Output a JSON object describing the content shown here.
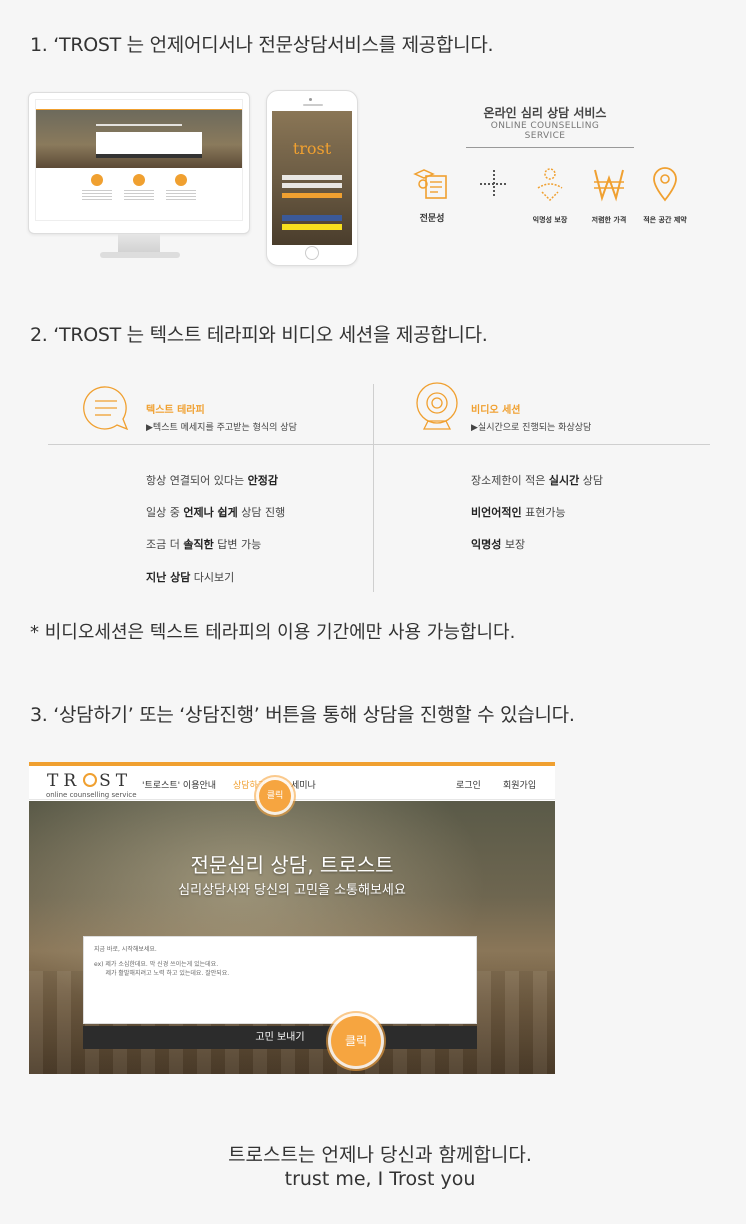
{
  "section1": {
    "title": "1. ‘TROST 는 언제어디서나 전문상담서비스를 제공합니다.",
    "service_title": "온라인 심리 상담 서비스",
    "service_subtitle": "ONLINE COUNSELLING SERVICE",
    "phone_logo": "trost",
    "features": [
      {
        "label": "전문성",
        "icon": "certificate-icon"
      },
      {
        "label": "",
        "icon": "plus-icon"
      },
      {
        "label": "익명성 보장",
        "icon": "anonymous-user-icon"
      },
      {
        "label": "저렴한 가격",
        "icon": "won-icon"
      },
      {
        "label": "적은 공간 제약",
        "icon": "location-pin-icon"
      }
    ]
  },
  "section2": {
    "title": "2. ‘TROST 는 텍스트 테라피와 비디오 세션을 제공합니다.",
    "text_therapy": {
      "heading": "텍스트 테라피",
      "desc": "텍스트 메세지를 주고받는 형식의 상담",
      "icon": "chat-bubble-icon",
      "points": [
        {
          "pre": "항상 연결되어 있다는 ",
          "bold": "안정감",
          "post": ""
        },
        {
          "pre": "일상 중 ",
          "bold": "언제나 쉽게",
          "post": " 상담 진행"
        },
        {
          "pre": "조금 더 ",
          "bold": "솔직한",
          "post": " 답변 가능"
        },
        {
          "pre": "",
          "bold": "지난 상담",
          "post": " 다시보기"
        }
      ]
    },
    "video_session": {
      "heading": "비디오 세션",
      "desc": "실시간으로 진행되는 화상상담",
      "icon": "webcam-icon",
      "points": [
        {
          "pre": "장소제한이 적은 ",
          "bold": "실시간",
          "post": " 상담"
        },
        {
          "pre": "",
          "bold": "비언어적인",
          "post": " 표현가능"
        },
        {
          "pre": "",
          "bold": "익명성",
          "post": " 보장"
        }
      ]
    }
  },
  "note": "* 비디오세션은 텍스트 테라피의 이용 기간에만 사용 가능합니다.",
  "section3": {
    "title": "3. ‘상담하기’ 또는 ‘상담진행’ 버튼을 통해 상담을 진행할 수 있습니다.",
    "screenshot": {
      "logo_pre": "TR",
      "logo_post": "ST",
      "logo_sub": "online counselling service",
      "nav": [
        "'트로스트' 이용안내",
        "상담하기",
        "세미나"
      ],
      "login": "로그인",
      "signup": "회원가입",
      "headline": "전문심리 상담, 트로스트",
      "subheadline": "심리상담사와 당신의 고민을 소통해보세요",
      "textarea_lines": [
        "지금 바로, 시작해보세요.",
        "ex) 제가 소심한데요. 막 신경 쓰이는게 있는데요.",
        "      제가 활발해지려고 노력 하고 있는데요. 잘안되요."
      ],
      "send_button": "고민 보내기",
      "click_badge": "클릭"
    }
  },
  "footer": {
    "line1": "트로스트는 언제나 당신과 함께합니다.",
    "line2": "trust me, I Trost you"
  },
  "colors": {
    "accent": "#f0a030",
    "text": "#333333",
    "background": "#f6f6f6"
  }
}
